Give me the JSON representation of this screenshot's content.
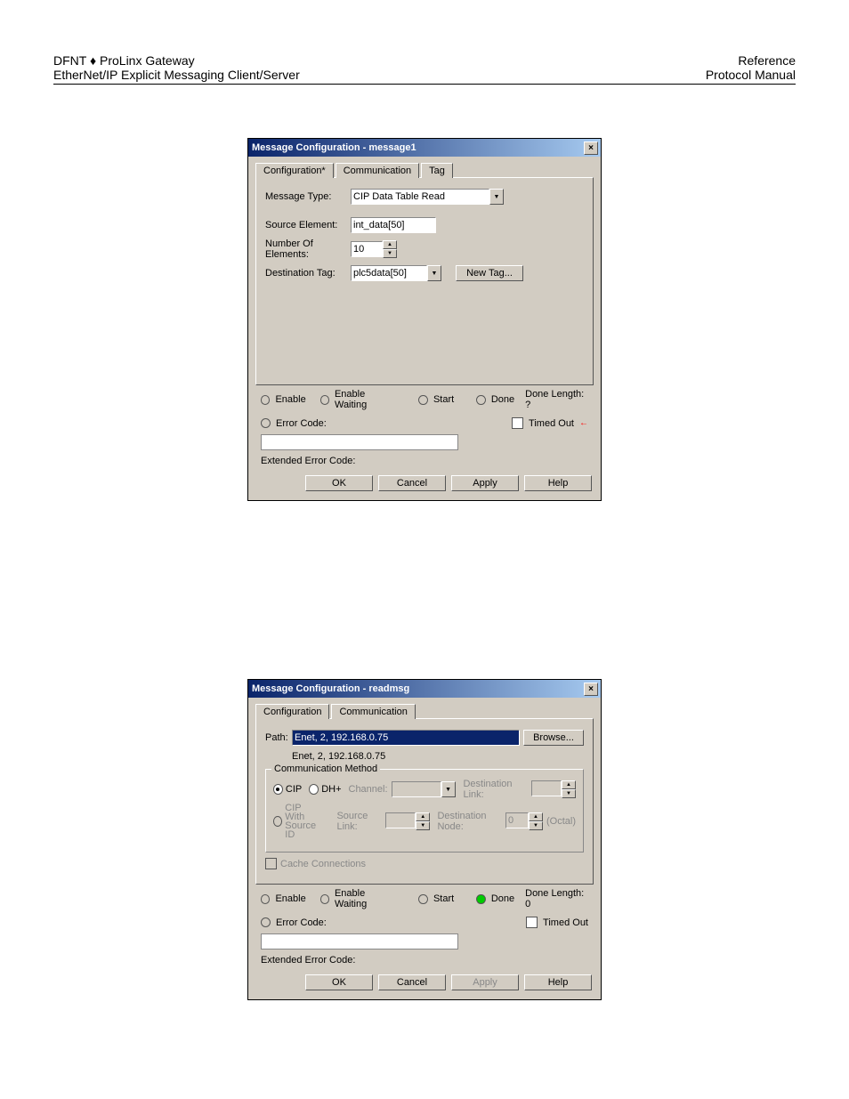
{
  "header": {
    "left1": "DFNT ♦ ProLinx Gateway",
    "left2": "EtherNet/IP Explicit Messaging Client/Server",
    "right1": "Reference",
    "right2": "Protocol Manual"
  },
  "dialog1": {
    "title": "Message Configuration - message1",
    "tabs": {
      "config": "Configuration*",
      "comm": "Communication",
      "tag": "Tag"
    },
    "labels": {
      "messageType": "Message Type:",
      "sourceElement": "Source Element:",
      "numElements": "Number Of Elements:",
      "destTag": "Destination Tag:"
    },
    "values": {
      "messageType": "CIP Data Table Read",
      "sourceElement": "int_data[50]",
      "numElements": "10",
      "destTag": "plc5data[50]"
    },
    "newTag": "New Tag...",
    "status": {
      "enable": "Enable",
      "enableWaiting": "Enable Waiting",
      "start": "Start",
      "done": "Done",
      "doneLength": "Done Length: ?",
      "errorCode": "Error Code:",
      "timedOut": "Timed Out",
      "extErrorCode": "Extended Error Code:"
    },
    "buttons": {
      "ok": "OK",
      "cancel": "Cancel",
      "apply": "Apply",
      "help": "Help"
    }
  },
  "dialog2": {
    "title": "Message Configuration - readmsg",
    "tabs": {
      "config": "Configuration",
      "comm": "Communication"
    },
    "pathLabel": "Path:",
    "pathValue": "Enet, 2, 192.168.0.75",
    "pathEcho": "Enet, 2, 192.168.0.75",
    "browse": "Browse...",
    "commMethod": {
      "legend": "Communication Method",
      "cip": "CIP",
      "dh": "DH+",
      "channel": "Channel:",
      "destLink": "Destination Link:",
      "cipWith": "CIP With Source ID",
      "sourceLink": "Source Link:",
      "destNode": "Destination Node:",
      "destNodeVal": "0",
      "octal": "(Octal)"
    },
    "cache": "Cache Connections",
    "status": {
      "enable": "Enable",
      "enableWaiting": "Enable Waiting",
      "start": "Start",
      "done": "Done",
      "doneLength": "Done Length: 0",
      "errorCode": "Error Code:",
      "timedOut": "Timed Out",
      "extErrorCode": "Extended Error Code:"
    },
    "buttons": {
      "ok": "OK",
      "cancel": "Cancel",
      "apply": "Apply",
      "help": "Help"
    }
  }
}
